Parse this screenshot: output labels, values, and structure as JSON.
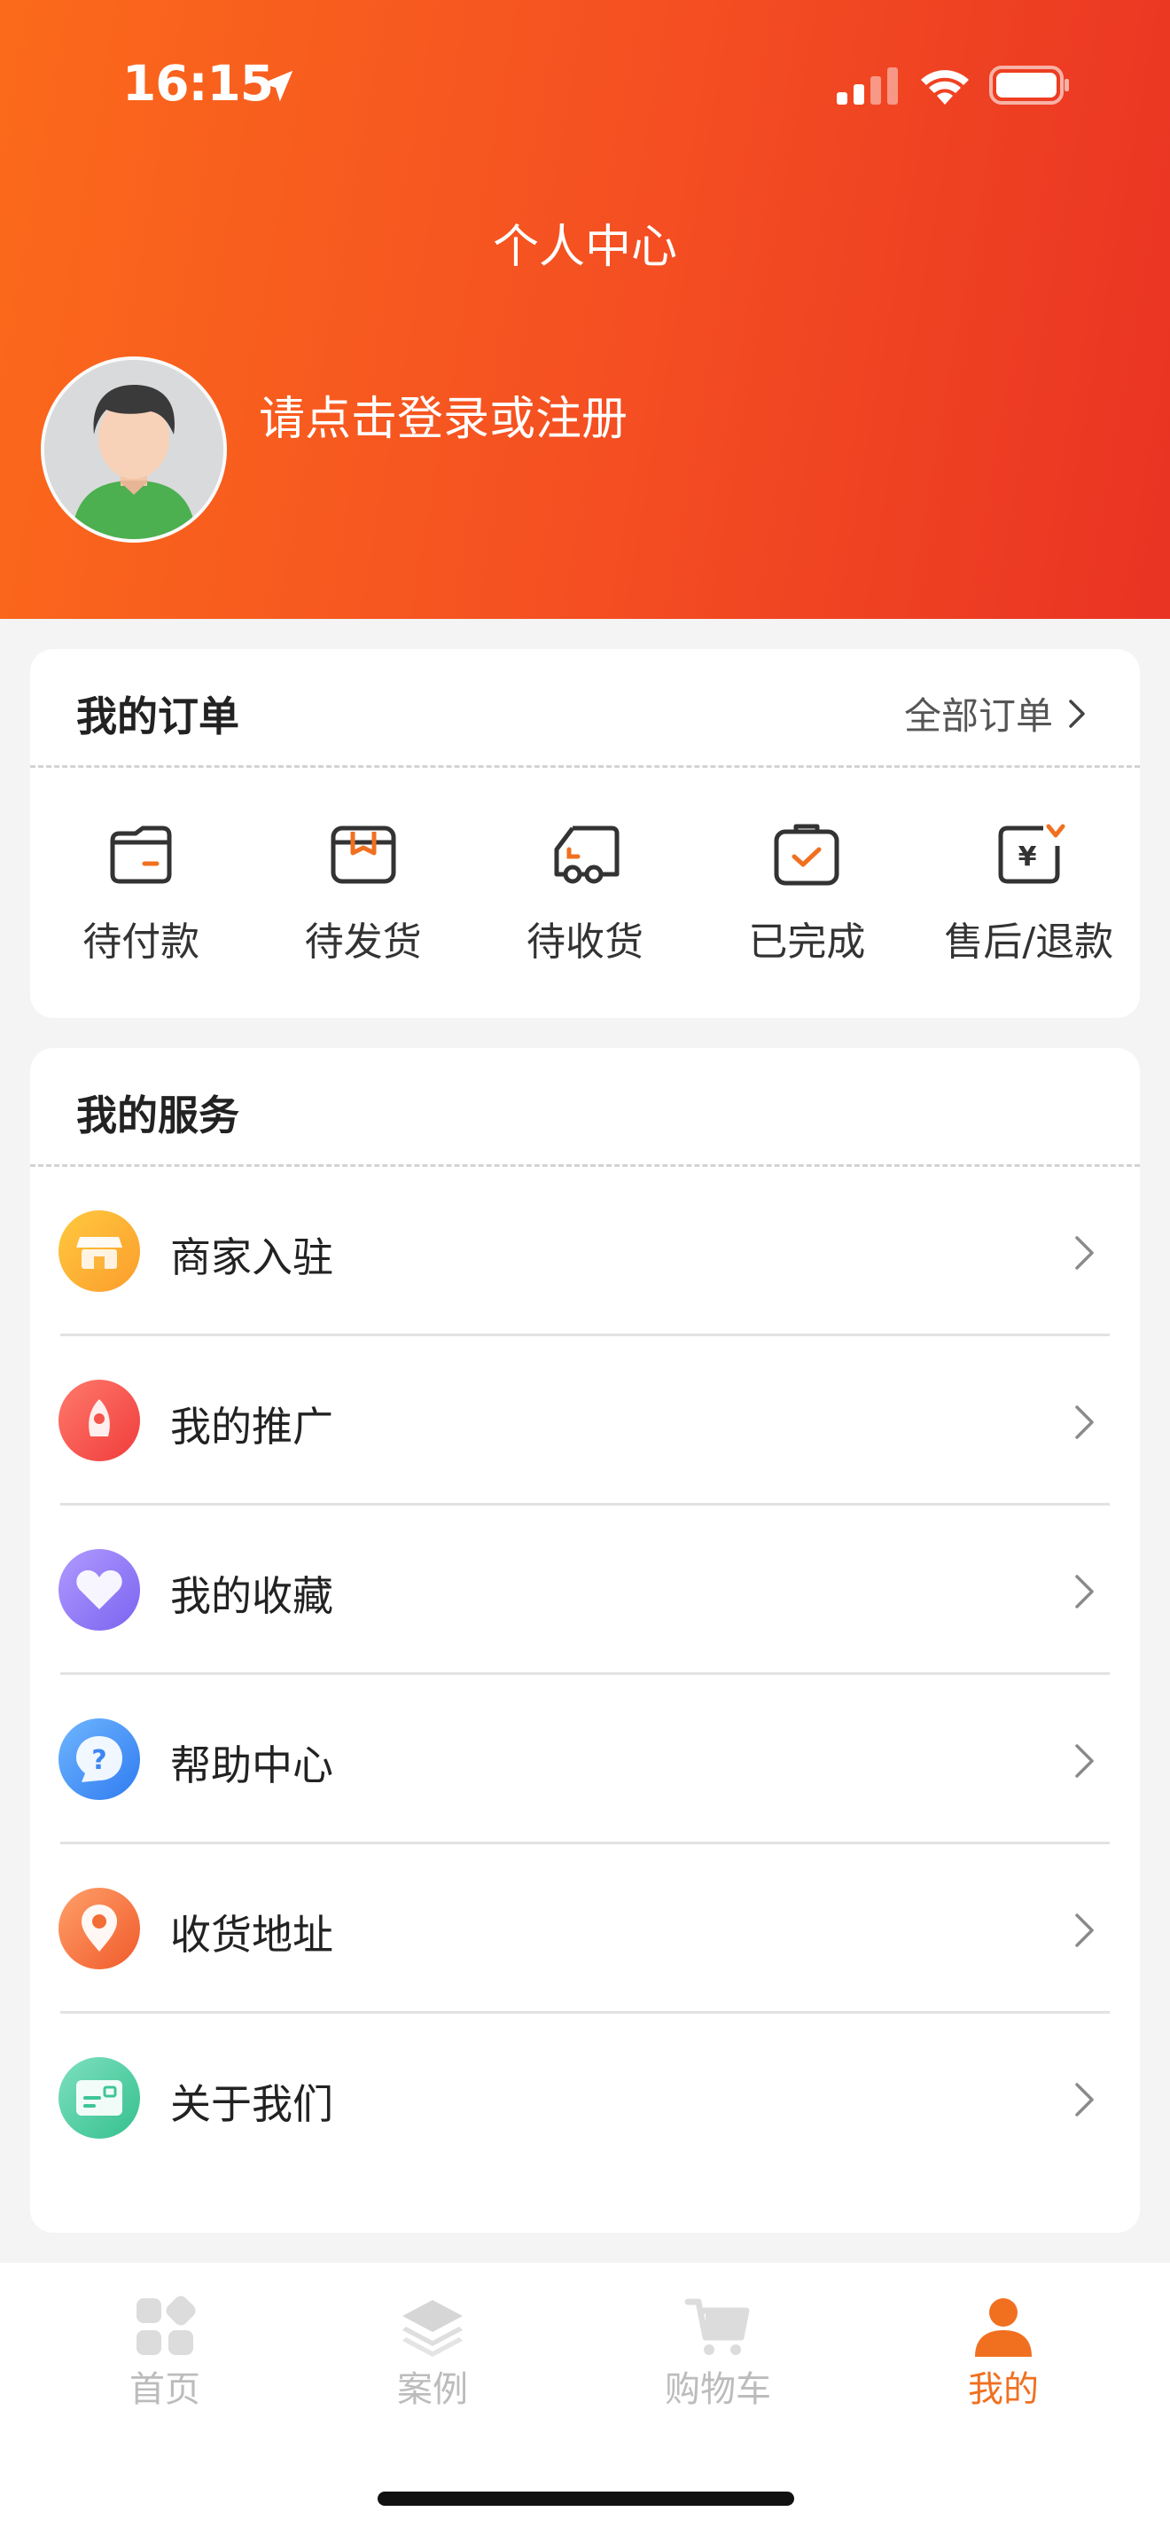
{
  "status_bar": {
    "time": "16:15"
  },
  "header": {
    "title": "个人中心",
    "login_prompt": "请点击登录或注册"
  },
  "orders": {
    "title": "我的订单",
    "all_link": "全部订单",
    "items": [
      {
        "label": "待付款",
        "icon": "wallet-icon"
      },
      {
        "label": "待发货",
        "icon": "package-box-icon"
      },
      {
        "label": "待收货",
        "icon": "truck-icon"
      },
      {
        "label": "已完成",
        "icon": "clipboard-check-icon"
      },
      {
        "label": "售后/退款",
        "icon": "yen-refund-icon"
      }
    ]
  },
  "services": {
    "title": "我的服务",
    "items": [
      {
        "label": "商家入驻",
        "icon": "shop-icon"
      },
      {
        "label": "我的推广",
        "icon": "promotion-icon"
      },
      {
        "label": "我的收藏",
        "icon": "heart-icon"
      },
      {
        "label": "帮助中心",
        "icon": "help-question-icon"
      },
      {
        "label": "收货地址",
        "icon": "location-pin-icon"
      },
      {
        "label": "关于我们",
        "icon": "info-card-icon"
      }
    ]
  },
  "tabbar": {
    "items": [
      {
        "label": "首页",
        "icon": "grid-home-icon",
        "active": false
      },
      {
        "label": "案例",
        "icon": "layers-icon",
        "active": false
      },
      {
        "label": "购物车",
        "icon": "cart-icon",
        "active": false
      },
      {
        "label": "我的",
        "icon": "user-icon",
        "active": true
      }
    ]
  },
  "colors": {
    "header_gradient_start": "#fb6a1b",
    "header_gradient_end": "#e93323",
    "accent": "#f07020",
    "tab_inactive": "#bcbcbc"
  }
}
